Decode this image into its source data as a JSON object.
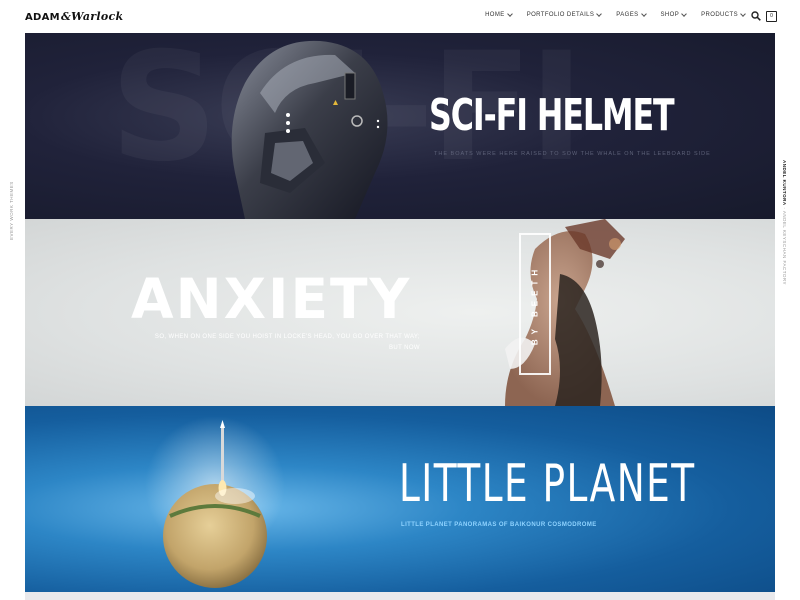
{
  "header": {
    "logo_main": "ADAM",
    "logo_script": "&Warlock",
    "nav": [
      "HOME",
      "PORTFOLIO DETAILS",
      "PAGES",
      "SHOP",
      "PRODUCTS"
    ],
    "cart_count": "0"
  },
  "side": {
    "left": "EVERY WORK THEMES",
    "right_bold": "ANDEL KUNTORA",
    "right_rest": " · ANDEL KEYSCHAN FACTORY"
  },
  "banners": [
    {
      "bg_word": "SCI-FI",
      "title": "SCI-FI HELMET",
      "subtitle": "THE BOATS WERE HERE RAISED TO SOW THE WHALE ON THE LEEBOARD SIDE"
    },
    {
      "title": "ANXIETY",
      "subtitle": "SO, WHEN ON ONE SIDE YOU HOIST IN LOCKE'S HEAD, YOU GO OVER THAT WAY; BUT NOW",
      "credit": "BY BEETH"
    },
    {
      "title": "LITTLE PLANET",
      "subtitle": "LITTLE PLANET PANORAMAS OF BAIKONUR COSMODROME"
    }
  ],
  "colors": {
    "banner1": "#1b1e32",
    "banner2": "#dfe2e2",
    "banner3": "#1f6fb0",
    "accent_sub3": "#8fd3ff"
  },
  "icons": [
    "search-icon",
    "cart-icon",
    "chevron-down-icon"
  ]
}
